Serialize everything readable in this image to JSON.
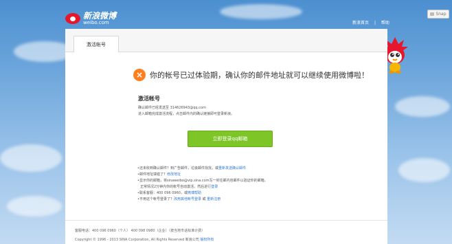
{
  "header": {
    "logo_cn": "新浪微博",
    "logo_en": "weibo.com",
    "nav": [
      "新浪首页",
      "|",
      "帮助"
    ],
    "snap_label": "Snap"
  },
  "tabs": [
    {
      "label": "激活帐号"
    }
  ],
  "notice": {
    "icon": "x-icon",
    "text": "你的帐号已过体验期，确认你的邮件地址就可以继续使用微博啦！"
  },
  "activation": {
    "title": "激活帐号",
    "line1": "确认邮件已经发送至 314626943@qq.com",
    "line2": "进入邮箱完成激活流程，点击邮件内的确认链接即可登录新浪。",
    "button": "立即登录qq邮箱"
  },
  "tips": {
    "t1_text": "•还未收到确认邮件？到广告邮件，垃圾邮件找找，或",
    "t1_link": "重新发送确认邮件",
    "t2_text": "•邮件地址填错了？",
    "t2_link": "修改地址",
    "t3_text": "•显示你的邮箱，将sinaweibo@vip.sina.com写一封往邮内容邮件以验证你的邮箱。",
    "t3_sub_text": "正常情况2分钟内你的帐号自动激活，然后进行",
    "t3_sub_link": "登录",
    "t4_text": "•联系客服：400 096 0960，或",
    "t4_link": "微博帮助",
    "t5_text": "•不用这个帐号登录了？",
    "t5_link1": "改用其他帐号登录",
    "t5_mid": "或",
    "t5_link2": "重新注册"
  },
  "footer": {
    "line1": "客服电话：400 096 0960（个人） 400 098 0980（企业）（按当地市话标准计费）",
    "line2": "Copyright © 1996 - 2013 SINA Corporation, All Rights Reserved 新浪公司",
    "line2_link": "版权所有"
  },
  "colors": {
    "accent_green": "#7ec627",
    "warning_orange": "#ff7e1f",
    "link_blue": "#2d78d0",
    "brand_red": "#e6162d"
  }
}
